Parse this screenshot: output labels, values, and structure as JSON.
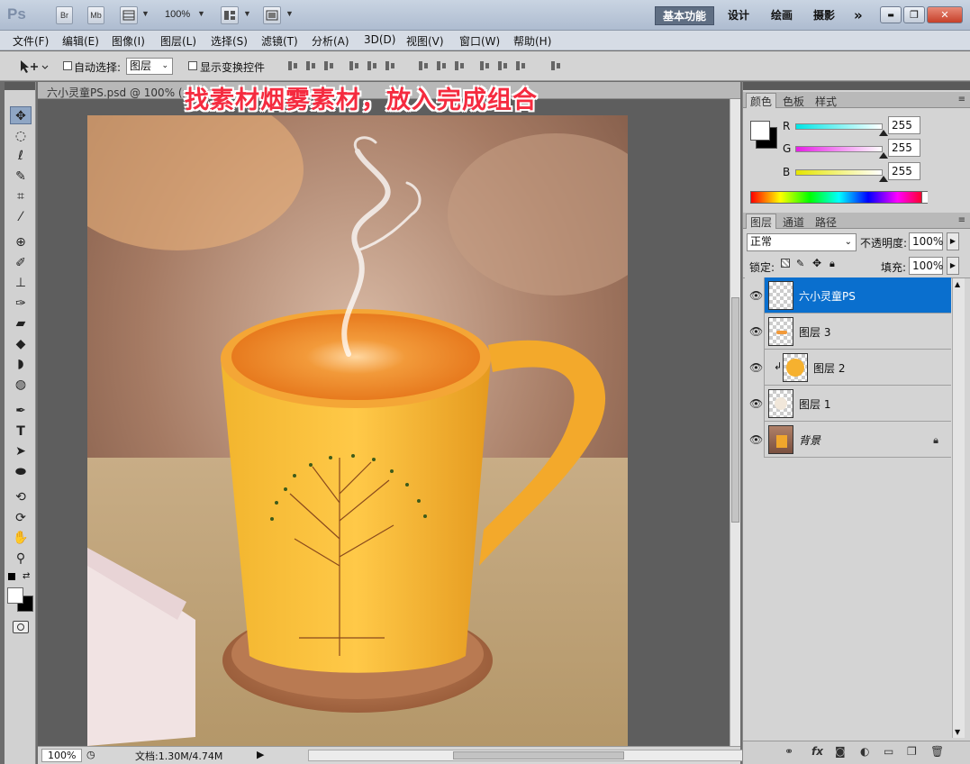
{
  "app": {
    "logo": "Ps",
    "bridge_btn": "Br",
    "minibridge_btn": "Mb",
    "zoom": "100%",
    "workspaces": [
      "基本功能",
      "设计",
      "绘画",
      "摄影"
    ],
    "more_workspaces": "»",
    "win_min": "▬",
    "win_restore": "❐",
    "win_close": "✕"
  },
  "menu": [
    "文件(F)",
    "编辑(E)",
    "图像(I)",
    "图层(L)",
    "选择(S)",
    "滤镜(T)",
    "分析(A)",
    "3D(D)",
    "视图(V)",
    "窗口(W)",
    "帮助(H)"
  ],
  "options": {
    "auto_select_label": "自动选择:",
    "auto_select_value": "图层",
    "show_transform_label": "显示变换控件"
  },
  "document": {
    "tab_title": "六小灵童PS.psd @ 100% (六",
    "caption": "找素材烟雾素材，放入完成组合",
    "zoom_status": "100%",
    "doc_info": "文档:1.30M/4.74M"
  },
  "color_panel": {
    "tabs": [
      "颜色",
      "色板",
      "样式"
    ],
    "channels": [
      {
        "label": "R",
        "value": "255",
        "color_from": "#00e5e5",
        "color_to": "#ffffff"
      },
      {
        "label": "G",
        "value": "255",
        "color_from": "#e51ee5",
        "color_to": "#ffffff"
      },
      {
        "label": "B",
        "value": "255",
        "color_from": "#e5e500",
        "color_to": "#ffffff"
      }
    ]
  },
  "layers_panel": {
    "tabs": [
      "图层",
      "通道",
      "路径"
    ],
    "blend_mode": "正常",
    "opacity_label": "不透明度:",
    "opacity_value": "100%",
    "lock_label": "锁定:",
    "fill_label": "填充:",
    "fill_value": "100%",
    "layers": [
      {
        "name": "六小灵童PS",
        "selected": true
      },
      {
        "name": "图层 3",
        "selected": false
      },
      {
        "name": "图层 2",
        "selected": false,
        "clipped": true
      },
      {
        "name": "图层 1",
        "selected": false
      },
      {
        "name": "背景",
        "selected": false,
        "locked": true
      }
    ]
  }
}
